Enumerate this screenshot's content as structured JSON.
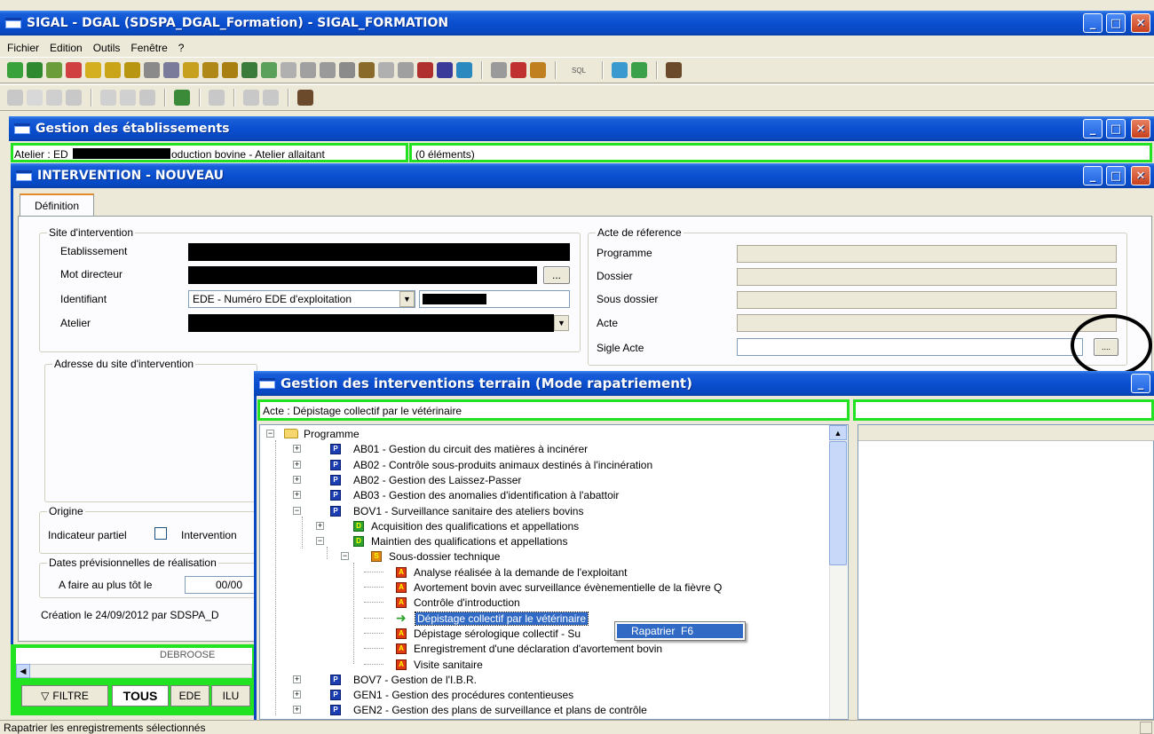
{
  "app": {
    "title": "SIGAL - DGAL (SDSPA_DGAL_Formation) - SIGAL_FORMATION",
    "menu": [
      "Fichier",
      "Edition",
      "Outils",
      "Fenêtre",
      "?"
    ],
    "toolbar_sql": "SQL",
    "status_text": "Rapatrier les enregistrements sélectionnés"
  },
  "gestion_etab": {
    "title": "Gestion des établissements",
    "atelier_text_a": "Atelier : ED",
    "atelier_text_b": "oduction bovine - Atelier allaitant",
    "count_text": "(0 éléments)"
  },
  "intervention": {
    "title": "INTERVENTION - NOUVEAU",
    "tab": "Définition",
    "site": {
      "legend": "Site d'intervention",
      "etablissement_label": "Etablissement",
      "mot_directeur_label": "Mot directeur",
      "identifiant_label": "Identifiant",
      "identifiant_value": "EDE - Numéro EDE d'exploitation",
      "atelier_label": "Atelier",
      "browse_label": "..."
    },
    "adresse_legend": "Adresse du site d'intervention",
    "origine_legend": "Origine",
    "indicateur_label": "Indicateur partiel",
    "intervention_label": "Intervention",
    "dates_legend": "Dates prévisionnelles de réalisation",
    "afaire_label": "A faire au plus tôt le",
    "afaire_value": "00/00",
    "creation_text": "Création le 24/09/2012 par SDSPA_D",
    "acte": {
      "legend": "Acte de réference",
      "programme_label": "Programme",
      "dossier_label": "Dossier",
      "sous_dossier_label": "Sous dossier",
      "acte_label": "Acte",
      "sigle_label": "Sigle Acte",
      "sigle_browse": "...."
    }
  },
  "bottom_tabs": {
    "filtre": "FILTRE",
    "tous": "TOUS",
    "ede": "EDE",
    "ilu": "ILU",
    "partial": "DEBROOSE"
  },
  "terrain": {
    "title": "Gestion des interventions terrain (Mode rapatriement)",
    "acte_text": "Acte : Dépistage collectif par le vétérinaire",
    "tree": [
      {
        "level": 0,
        "icon": "folder",
        "text": "Programme",
        "exp": "-"
      },
      {
        "level": 1,
        "icon": "P",
        "text": "AB01 - Gestion du circuit des matières à incinérer",
        "exp": "+"
      },
      {
        "level": 1,
        "icon": "P",
        "text": "AB02 - Contrôle sous-produits animaux destinés à l'incinération",
        "exp": "+"
      },
      {
        "level": 1,
        "icon": "P",
        "text": "AB02 - Gestion des Laissez-Passer",
        "exp": "+"
      },
      {
        "level": 1,
        "icon": "P",
        "text": "AB03 - Gestion des anomalies d'identification à l'abattoir",
        "exp": "+"
      },
      {
        "level": 1,
        "icon": "P",
        "text": "BOV1 - Surveillance sanitaire des ateliers bovins",
        "exp": "-"
      },
      {
        "level": 2,
        "icon": "D",
        "text": "Acquisition des qualifications et appellations",
        "exp": "+"
      },
      {
        "level": 2,
        "icon": "D",
        "text": "Maintien des qualifications et appellations",
        "exp": "-"
      },
      {
        "level": 3,
        "icon": "S",
        "text": "Sous-dossier technique",
        "exp": "-"
      },
      {
        "level": 4,
        "icon": "A",
        "text": "Analyse réalisée à la demande de l'exploitant",
        "exp": ""
      },
      {
        "level": 4,
        "icon": "A",
        "text": "Avortement bovin avec surveillance évènementielle de la fièvre Q",
        "exp": ""
      },
      {
        "level": 4,
        "icon": "A",
        "text": "Contrôle d'introduction",
        "exp": ""
      },
      {
        "level": 4,
        "icon": "arrow",
        "text": "Dépistage collectif par le vétérinaire",
        "exp": "",
        "selected": true
      },
      {
        "level": 4,
        "icon": "A",
        "text": "Dépistage sérologique collectif - Su",
        "exp": ""
      },
      {
        "level": 4,
        "icon": "A",
        "text": "Enregistrement d'une déclaration d'avortement bovin",
        "exp": ""
      },
      {
        "level": 4,
        "icon": "A",
        "text": "Visite sanitaire",
        "exp": ""
      },
      {
        "level": 1,
        "icon": "P",
        "text": "BOV7 - Gestion de l'I.B.R.",
        "exp": "+"
      },
      {
        "level": 1,
        "icon": "P",
        "text": "GEN1 - Gestion des procédures contentieuses",
        "exp": "+"
      },
      {
        "level": 1,
        "icon": "P",
        "text": "GEN2 - Gestion des plans de surveillance et plans de contrôle",
        "exp": "+"
      }
    ],
    "context_menu": "Rapatrier  F6"
  }
}
